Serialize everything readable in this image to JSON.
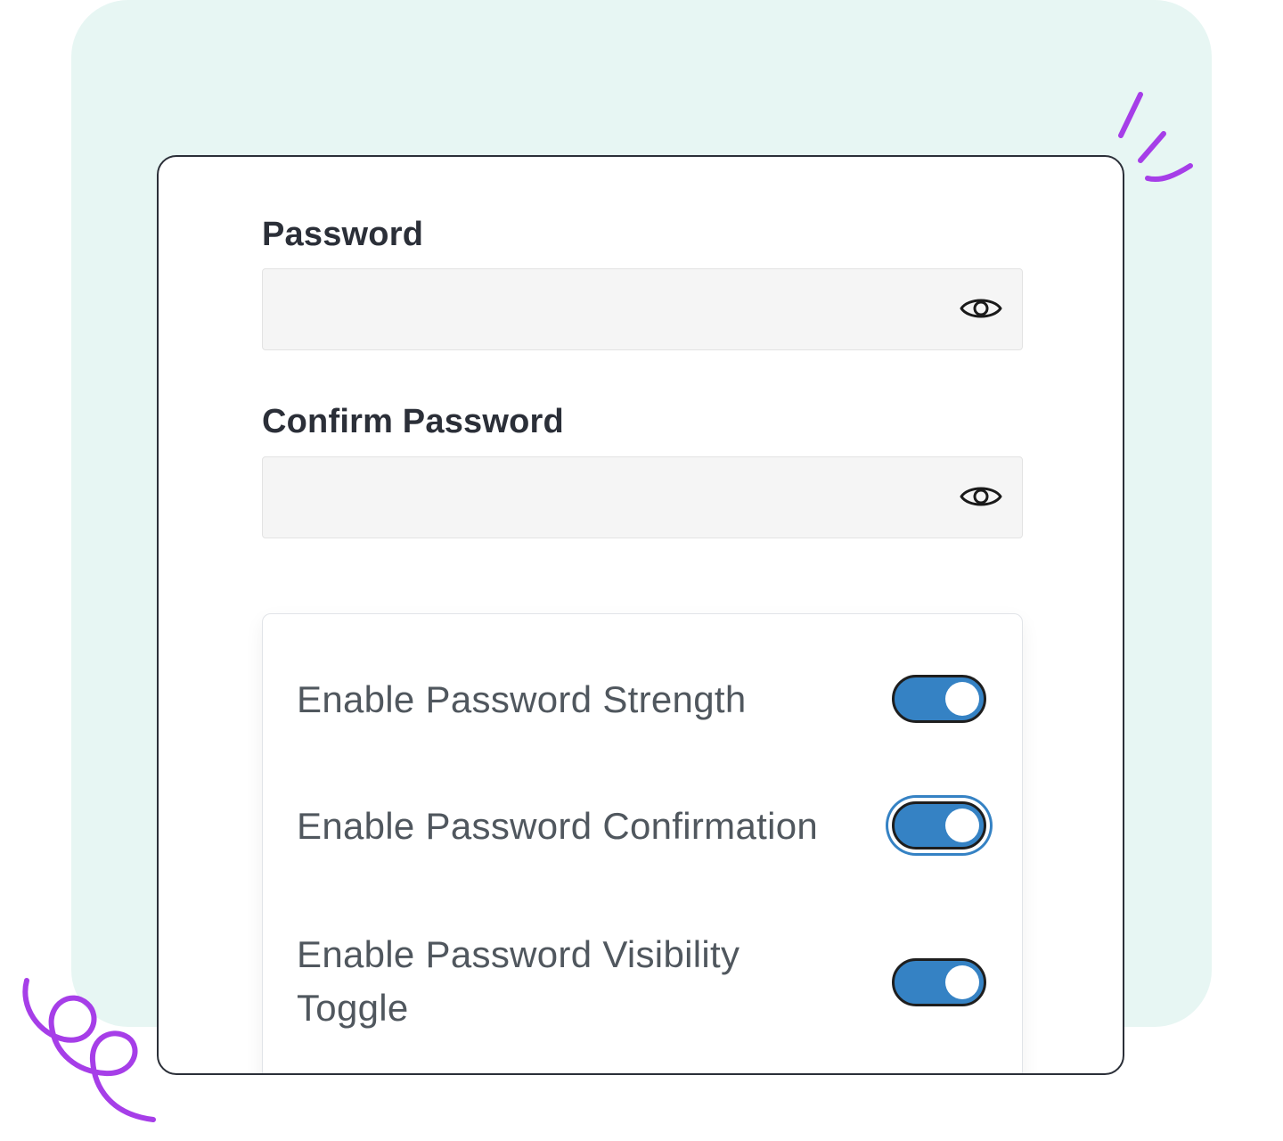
{
  "form": {
    "password": {
      "label": "Password",
      "value": "",
      "placeholder": ""
    },
    "confirm_password": {
      "label": "Confirm Password",
      "value": "",
      "placeholder": ""
    }
  },
  "icons": {
    "password_visibility": "eye-icon",
    "confirm_visibility": "eye-icon"
  },
  "settings": [
    {
      "label": "Enable Password Strength",
      "enabled": true,
      "focused": false
    },
    {
      "label": "Enable Password Confirmation",
      "enabled": true,
      "focused": true
    },
    {
      "label": "Enable Password Visibility Toggle",
      "enabled": true,
      "focused": false
    }
  ],
  "colors": {
    "background_panel": "#e7f6f3",
    "toggle_on": "#3582c4",
    "decoration": "#a63ee8"
  }
}
